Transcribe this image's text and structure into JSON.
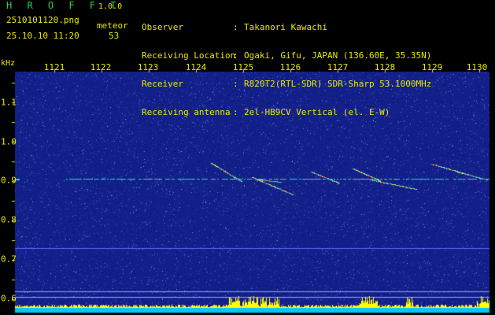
{
  "app": {
    "name": "H R O F F T",
    "version": "1.0.0"
  },
  "capture": {
    "filename": "2510101120.png",
    "datetime": "25.10.10 11:20",
    "meteor_label": "meteor",
    "meteor_count": "53"
  },
  "meta": [
    {
      "key": "Observer",
      "value": "Takanori Kawachi"
    },
    {
      "key": "Receiving Location",
      "value": "Ogaki, Gifu, JAPAN (136.60E, 35.35N)"
    },
    {
      "key": "Receiver",
      "value": "R820T2(RTL-SDR) SDR-Sharp 53.1000MHz"
    },
    {
      "key": "Receiving antenna",
      "value": "2el-HB9CV Vertical (el. E-W)"
    }
  ],
  "axis": {
    "y_unit": "kHz",
    "x_ticks": [
      "1121",
      "1122",
      "1123",
      "1124",
      "1125",
      "1126",
      "1127",
      "1128",
      "1129",
      "1130"
    ],
    "y_ticks": [
      "1.1",
      "1.0",
      "0.9",
      "0.8",
      "0.7",
      "0.6"
    ]
  },
  "colors": {
    "background": "#1a2a9a",
    "text": "#e8e800",
    "title": "#2bd04a",
    "baseline": "#00c8ff",
    "signal": "#ff3030"
  }
}
